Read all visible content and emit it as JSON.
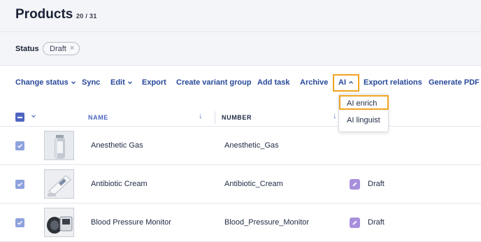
{
  "header": {
    "title": "Products",
    "count": "20 / 31"
  },
  "filters": {
    "label": "Status",
    "chip": {
      "label": "Draft",
      "remove_icon": "close-icon"
    }
  },
  "toolbar": {
    "items": [
      {
        "label": "Change status",
        "has_chevron": true
      },
      {
        "label": "Sync"
      },
      {
        "label": "Edit",
        "has_chevron": true
      },
      {
        "label": "Export"
      },
      {
        "label": "Create variant group"
      },
      {
        "label": "Add task"
      },
      {
        "label": "Archive"
      },
      {
        "label": "AI",
        "has_chevron": true,
        "expanded": true
      },
      {
        "label": "Export relations"
      },
      {
        "label": "Generate PDF"
      }
    ]
  },
  "ai_menu": {
    "items": [
      "AI enrich",
      "AI linguist"
    ],
    "highlighted": "AI enrich"
  },
  "table": {
    "columns": [
      "NAME",
      "NUMBER"
    ],
    "rows": [
      {
        "name": "Anesthetic Gas",
        "number": "Anesthetic_Gas",
        "status": "",
        "checked": true,
        "thumb": "gas-cylinder-image"
      },
      {
        "name": "Antibiotic Cream",
        "number": "Antibiotic_Cream",
        "status": "Draft",
        "checked": true,
        "thumb": "cream-tube-image"
      },
      {
        "name": "Blood Pressure Monitor",
        "number": "Blood_Pressure_Monitor",
        "status": "Draft",
        "checked": true,
        "thumb": "blood-pressure-monitor-image"
      }
    ]
  },
  "colors": {
    "accent": "#27489a",
    "highlight": "#f0a420",
    "checkbox": "#8ea2dc",
    "status": "#a88fdc",
    "header_bg": "#f4f5f8"
  }
}
